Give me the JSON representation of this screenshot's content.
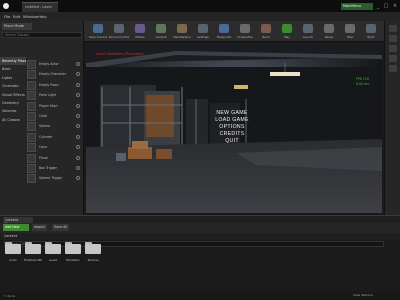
{
  "window": {
    "tab_label": "Untitled - Level",
    "project_name": "MainMenu",
    "buttons": [
      "_",
      "□",
      "×"
    ]
  },
  "menu": {
    "items": [
      "File",
      "Edit",
      "Window",
      "Help"
    ]
  },
  "modes_panel": {
    "tab_label": "Place Mode",
    "search_placeholder": "Search Classes",
    "categories": [
      "Recently Placed",
      "Basic",
      "Lights",
      "Cinematic",
      "Visual Effects",
      "Geometry",
      "Volumes",
      "All Classes"
    ],
    "assets": [
      "Empty Actor",
      "Empty Character",
      "Empty Pawn",
      "Point Light",
      "Player Start",
      "Cube",
      "Sphere",
      "Cylinder",
      "Cone",
      "Plane",
      "Box Trigger",
      "Sphere Trigger"
    ]
  },
  "toolbar": {
    "buttons": [
      {
        "label": "Save Current",
        "icon": "save-icon"
      },
      {
        "label": "Source Control",
        "icon": "source-control-icon"
      },
      {
        "label": "Modes",
        "icon": "modes-icon"
      },
      {
        "label": "Content",
        "icon": "content-icon"
      },
      {
        "label": "Marketplace",
        "icon": "marketplace-icon"
      },
      {
        "label": "Settings",
        "icon": "settings-icon"
      },
      {
        "label": "Blueprints",
        "icon": "blueprints-icon"
      },
      {
        "label": "Cinematics",
        "icon": "cinematics-icon"
      },
      {
        "label": "Build",
        "icon": "build-icon"
      },
      {
        "label": "Play",
        "icon": "play-icon"
      },
      {
        "label": "Launch",
        "icon": "launch-icon"
      },
      {
        "label": "Pause",
        "icon": "pause-icon"
      },
      {
        "label": "Stop",
        "icon": "stop-icon"
      },
      {
        "label": "Eject",
        "icon": "eject-icon"
      }
    ]
  },
  "viewport": {
    "info_text": "Level: MainMenu (Persistent)",
    "stats": [
      "FPS 120",
      "0.00 ms"
    ],
    "main_menu": [
      "NEW GAME",
      "LOAD GAME",
      "OPTIONS",
      "CREDITS",
      "QUIT"
    ]
  },
  "content_browser": {
    "tab_label": "Content Browser",
    "add_new_label": "Add New",
    "import_label": "Import",
    "save_all_label": "Save All",
    "breadcrumb": "Content",
    "search_placeholder": "Search Content",
    "filters_label": "Filters",
    "folders": [
      "Audio",
      "FirstPersonBP",
      "Levels",
      "MainMenu",
      "Textures"
    ],
    "item_count": "5 items",
    "view_options": "View Options"
  },
  "colors": {
    "accent_green": "#3f8a2e",
    "viewport_text_red": "#d03030",
    "stat_green": "#3cc43c"
  }
}
